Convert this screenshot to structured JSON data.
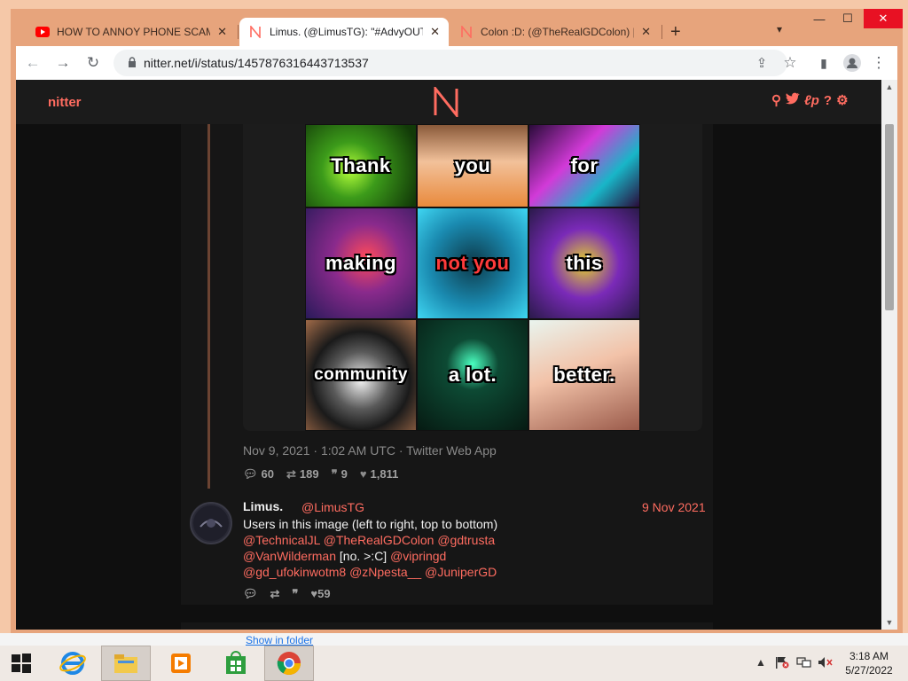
{
  "browser": {
    "tabs": [
      {
        "title": "HOW TO ANNOY PHONE SCAMM",
        "favicon": "youtube-icon",
        "active": false
      },
      {
        "title": "Limus. (@LimusTG): \"#AdvyOUT",
        "favicon": "nitter-icon",
        "active": true
      },
      {
        "title": "Colon :D: (@TheRealGDColon) | n",
        "favicon": "nitter-icon",
        "active": false
      }
    ],
    "url": "nitter.net/i/status/1457876316443713537"
  },
  "nitter": {
    "brand": "nitter",
    "nav_icons": [
      "search-icon",
      "twitter-icon",
      "lp-icon",
      "help-icon",
      "settings-icon"
    ]
  },
  "collage": {
    "tiles": [
      {
        "caption": "Thank",
        "bg": "#2f7d14"
      },
      {
        "caption": "you",
        "bg": "#f0b488"
      },
      {
        "caption": "for",
        "bg": "#4a1f5c"
      },
      {
        "caption": "making",
        "bg": "#6a2a8c"
      },
      {
        "caption_a": "not",
        "caption_b": "you",
        "bg": "#1aa3c8"
      },
      {
        "caption": "this",
        "bg": "#5a2aa0"
      },
      {
        "caption": "community",
        "bg": "#6b4a36"
      },
      {
        "caption": "a lot.",
        "bg": "#0d2a1f"
      },
      {
        "caption": "better.",
        "bg": "#c9e0d6"
      }
    ]
  },
  "tweet": {
    "date": "Nov 9, 2021 · 1:02 AM UTC · Twitter Web App",
    "stats": {
      "replies": "60",
      "retweets": "189",
      "quotes": "9",
      "likes": "1,811"
    }
  },
  "reply": {
    "name": "Limus.",
    "handle": "@LimusTG",
    "date": "9 Nov 2021",
    "text": "Users in this image (left to right, top to bottom)",
    "mentions": {
      "m1": "@TechnicalJL",
      "m2": "@TheRealGDColon",
      "m3": "@gdtrusta",
      "m4": "@VanWilderman",
      "inline": "[no. >:C]",
      "m5": "@vipringd",
      "m6": "@gd_ufokinwotm8",
      "m7": "@zNpesta__",
      "m8": "@JuniperGD"
    },
    "stats": {
      "likes": "59"
    }
  },
  "download_bar": {
    "link": "Show in folder"
  },
  "taskbar": {
    "clock_time": "3:18 AM",
    "clock_date": "5/27/2022"
  },
  "colors": {
    "accent": "#ff6c60",
    "bg": "#0f0f0f",
    "panel": "#161616"
  }
}
